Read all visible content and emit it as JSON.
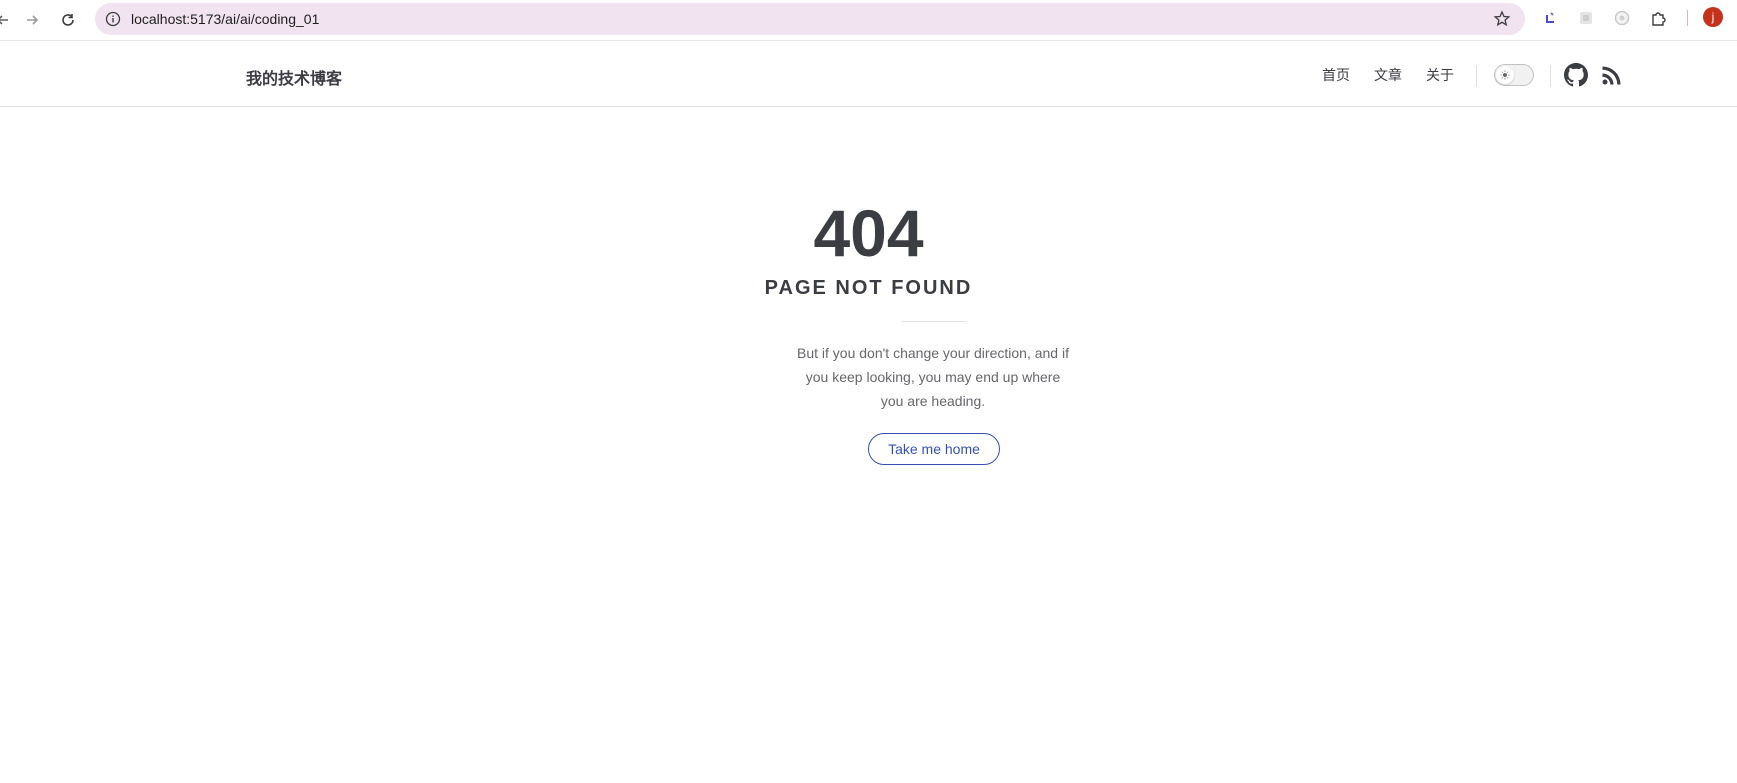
{
  "browser": {
    "url": "localhost:5173/ai/ai/coding_01",
    "avatar_letter": "j",
    "colors": {
      "omnibox": "#f1e3ef",
      "avatar": "#c5321c"
    }
  },
  "site": {
    "title": "我的技术博客",
    "nav": [
      {
        "label": "首页"
      },
      {
        "label": "文章"
      },
      {
        "label": "关于"
      }
    ],
    "theme": "light"
  },
  "not_found": {
    "code": "404",
    "title": "PAGE NOT FOUND",
    "quote": "But if you don't change your direction, and if you keep looking, you may end up where you are heading.",
    "button_label": "Take me home",
    "colors": {
      "accent": "#3451b2",
      "text": "#3c3c43",
      "muted": "#67676c"
    }
  }
}
